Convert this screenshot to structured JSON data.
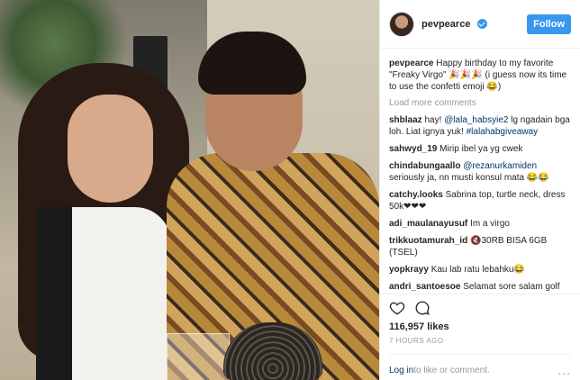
{
  "post": {
    "username": "pevpearce",
    "follow_label": "Follow",
    "caption": {
      "user": "pevpearce",
      "text": "Happy birthday to my favorite \"Freaky Virgo\" 🎉🎉🎉 (i guess now its time to use the confetti emoji 😂)"
    },
    "load_more_label": "Load more comments",
    "comments": [
      {
        "user": "shblaaz",
        "parts": [
          {
            "t": "hay! "
          },
          {
            "t": "@lala_habsyie2",
            "link": true
          },
          {
            "t": " lg ngadain bga loh. Liat ignya yuk! "
          },
          {
            "t": "#lalahabgiveaway",
            "link": true
          }
        ]
      },
      {
        "user": "sahwyd_19",
        "parts": [
          {
            "t": "Mirip ibel ya yg cwek"
          }
        ]
      },
      {
        "user": "chindabungaallo",
        "parts": [
          {
            "t": "@rezanurkamiden",
            "link": true
          },
          {
            "t": " seriously ja, nn musti konsul mata 😂😂"
          }
        ]
      },
      {
        "user": "catchy.looks",
        "parts": [
          {
            "t": "Sabrina top, turtle neck, dress 50k❤❤❤"
          }
        ]
      },
      {
        "user": "adi_maulanayusuf",
        "parts": [
          {
            "t": "Im a virgo"
          }
        ]
      },
      {
        "user": "trikkuotamurah_id",
        "parts": [
          {
            "t": "🔇30RB BISA 6GB (TSEL)"
          }
        ]
      },
      {
        "user": "yopkrayy",
        "parts": [
          {
            "t": "Kau lab ratu lebahku😂"
          }
        ]
      },
      {
        "user": "andri_santoesoe",
        "parts": [
          {
            "t": "Selamat sore salam golf mania, dijual hunian exlusive termegah dan"
          }
        ]
      }
    ],
    "likes": "116,957 likes",
    "time": "7 HOURS AGO",
    "login_link": "Log in",
    "login_text": " to like or comment.",
    "more_icon": "..."
  }
}
